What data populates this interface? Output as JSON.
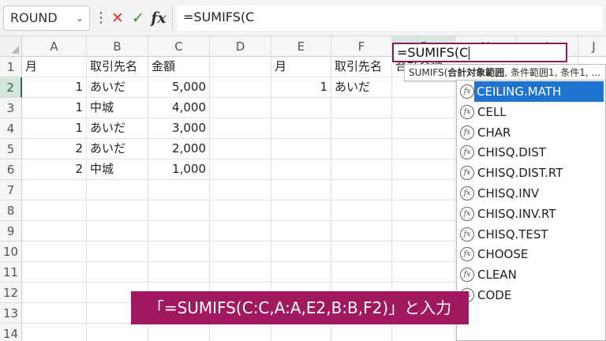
{
  "formula_bar": {
    "name_box": "ROUND",
    "name_box_caret": "⌄",
    "more_icon": "⋮",
    "cancel_icon": "✕",
    "enter_icon": "✓",
    "insert_function_icon": "fx",
    "formula": "=SUMIFS(C"
  },
  "columns": [
    "A",
    "B",
    "C",
    "D",
    "E",
    "F",
    "G",
    "H",
    "I",
    "J"
  ],
  "rows": [
    "1",
    "2",
    "3",
    "4",
    "5",
    "6",
    "7",
    "8",
    "9",
    "10",
    "11",
    "12",
    "13",
    "14"
  ],
  "cells": {
    "A1": "月",
    "B1": "取引先名",
    "C1": "金額",
    "E1": "月",
    "F1": "取引先名",
    "G1": "合計金額",
    "A2": "1",
    "B2": "あいだ",
    "C2": "5,000",
    "E2": "1",
    "F2": "あいだ",
    "A3": "1",
    "B3": "中城",
    "C3": "4,000",
    "A4": "1",
    "B4": "あいだ",
    "C4": "3,000",
    "A5": "2",
    "B5": "あいだ",
    "C5": "2,000",
    "A6": "2",
    "B6": "中城",
    "C6": "1,000"
  },
  "active_cell": {
    "ref": "G2",
    "content": "=SUMIFS(C"
  },
  "tooltip": {
    "func": "SUMIFS(",
    "bold_arg": "合計対象範囲",
    "rest": ", 条件範囲1, 条件1, ..."
  },
  "autocomplete": [
    "CEILING.MATH",
    "CELL",
    "CHAR",
    "CHISQ.DIST",
    "CHISQ.DIST.RT",
    "CHISQ.INV",
    "CHISQ.INV.RT",
    "CHISQ.TEST",
    "CHOOSE",
    "CLEAN",
    "CODE"
  ],
  "autocomplete_icon": "fx",
  "caption": "「=SUMIFS(C:C,A:A,E2,B:B,F2)」と入力",
  "colors": {
    "accent": "#a0185e",
    "selection": "#1f74d2",
    "excel_green": "#217346"
  }
}
